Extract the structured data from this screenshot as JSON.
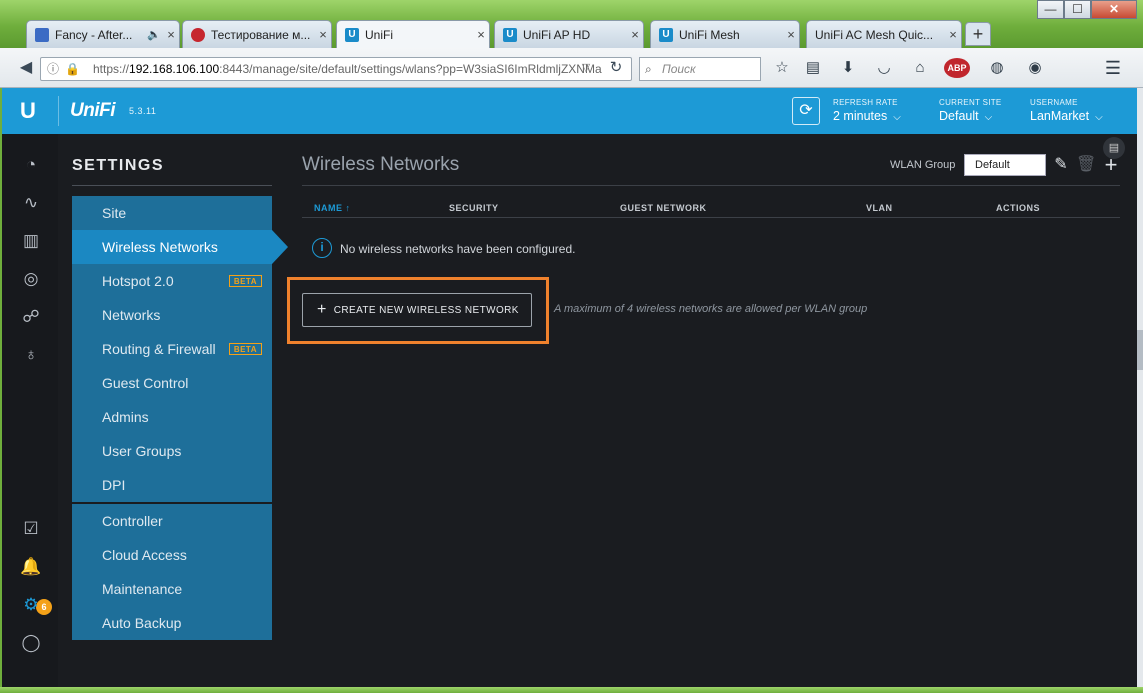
{
  "browser": {
    "tabs": [
      {
        "title": "Fancy - After...",
        "icon": "play-icon",
        "extra": "🔈"
      },
      {
        "title": "Тестирование м...",
        "icon": "red-circle-icon"
      },
      {
        "title": "UniFi",
        "icon": "unifi-icon",
        "active": true
      },
      {
        "title": "UniFi AP HD",
        "icon": "unifi-icon"
      },
      {
        "title": "UniFi Mesh",
        "icon": "unifi-icon"
      },
      {
        "title": "UniFi AC Mesh Quic...",
        "icon": "unifi-icon"
      }
    ],
    "url_prefix": "https://",
    "url_host": "192.168.106.100",
    "url_rest": ":8443/manage/site/default/settings/wlans?pp=W3siaSI6ImRldmljZXNMa",
    "search_placeholder": "Поиск",
    "tab_close": "×",
    "new_tab": "+",
    "window_buttons": {
      "minimize": "—",
      "maximize": "☐",
      "close": "✕"
    }
  },
  "app": {
    "brand": "UniFi",
    "logo": "U",
    "version": "5.3.11",
    "accent": "#1d9ad6",
    "refresh_rate": {
      "label": "REFRESH RATE",
      "value": "2 minutes"
    },
    "current_site": {
      "label": "CURRENT SITE",
      "value": "Default"
    },
    "username": {
      "label": "USERNAME",
      "value": "LanMarket"
    },
    "notifications_count": "6"
  },
  "settings": {
    "title": "SETTINGS",
    "group1": [
      {
        "label": "Site"
      },
      {
        "label": "Wireless Networks",
        "active": true
      },
      {
        "label": "Hotspot 2.0",
        "badge": "BETA"
      },
      {
        "label": "Networks"
      },
      {
        "label": "Routing & Firewall",
        "badge": "BETA"
      },
      {
        "label": "Guest Control"
      },
      {
        "label": "Admins"
      },
      {
        "label": "User Groups"
      },
      {
        "label": "DPI"
      }
    ],
    "group2": [
      {
        "label": "Controller"
      },
      {
        "label": "Cloud Access"
      },
      {
        "label": "Maintenance"
      },
      {
        "label": "Auto Backup"
      }
    ]
  },
  "content": {
    "title": "Wireless Networks",
    "wlan_group_label": "WLAN Group",
    "wlan_group_value": "Default",
    "columns": [
      "NAME ↑",
      "SECURITY",
      "GUEST NETWORK",
      "VLAN",
      "ACTIONS"
    ],
    "empty_message": "No wireless networks have been configured.",
    "create_button": "CREATE NEW WIRELESS NETWORK",
    "max_note": "A maximum of 4 wireless networks are allowed per WLAN group",
    "highlight_color": "#f0822d"
  }
}
